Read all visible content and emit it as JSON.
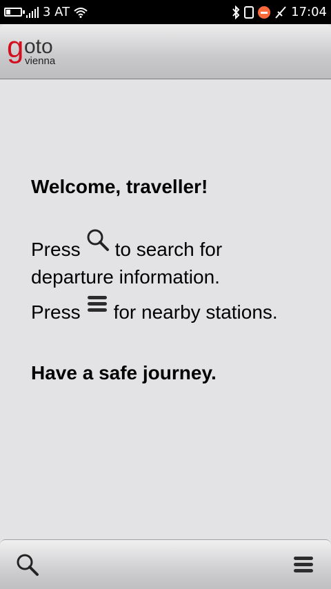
{
  "status_bar": {
    "carrier": "3 AT",
    "time": "17:04",
    "icons": [
      "battery-icon",
      "signal-icon",
      "wifi-icon",
      "bluetooth-icon",
      "sim-icon",
      "do-not-disturb-icon",
      "usb-icon"
    ]
  },
  "header": {
    "logo_g": "g",
    "logo_oto": "oto",
    "logo_sub": "vienna"
  },
  "main": {
    "welcome": "Welcome, traveller!",
    "line1_press": "Press",
    "line1_rest": "to search for",
    "line1_cont": "departure information.",
    "line2_press": "Press",
    "line2_rest": "for nearby stations.",
    "farewell": "Have a safe journey."
  },
  "toolbar": {
    "icons": [
      "search-icon",
      "menu-icon"
    ]
  },
  "colors": {
    "background": "#e3e3e5",
    "logo_red": "#d10f1f",
    "status_bar": "#000000"
  }
}
